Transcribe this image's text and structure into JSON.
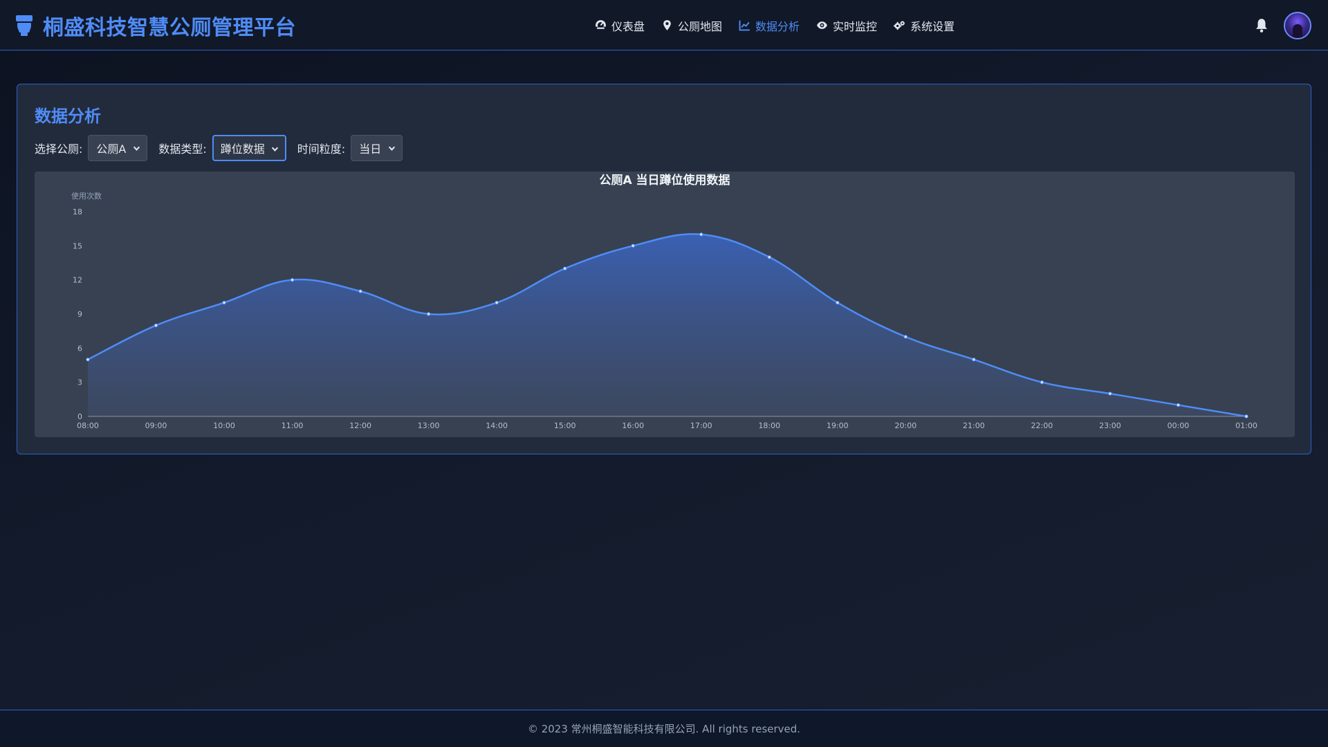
{
  "header": {
    "brand_title": "桐盛科技智慧公厕管理平台",
    "brand_icon": "toilet-icon",
    "nav": [
      {
        "label": "仪表盘",
        "icon": "gauge-icon",
        "active": false
      },
      {
        "label": "公厕地图",
        "icon": "map-pin-icon",
        "active": false
      },
      {
        "label": "数据分析",
        "icon": "chart-line-icon",
        "active": true
      },
      {
        "label": "实时监控",
        "icon": "eye-icon",
        "active": false
      },
      {
        "label": "系统设置",
        "icon": "gears-icon",
        "active": false
      }
    ],
    "notification_icon": "bell-icon",
    "accent_color": "#4f8cf7"
  },
  "panel": {
    "title": "数据分析",
    "filters": [
      {
        "label": "选择公厕:",
        "value": "公厕A"
      },
      {
        "label": "数据类型:",
        "value": "蹲位数据"
      },
      {
        "label": "时间粒度:",
        "value": "当日"
      }
    ]
  },
  "chart_data": {
    "type": "area",
    "title": "公厕A 当日蹲位使用数据",
    "ylabel": "使用次数",
    "xlabel": "",
    "categories": [
      "08:00",
      "09:00",
      "10:00",
      "11:00",
      "12:00",
      "13:00",
      "14:00",
      "15:00",
      "16:00",
      "17:00",
      "18:00",
      "19:00",
      "20:00",
      "21:00",
      "22:00",
      "23:00",
      "00:00",
      "01:00"
    ],
    "values": [
      5,
      8,
      10,
      12,
      11,
      9,
      10,
      13,
      15,
      16,
      14,
      10,
      7,
      5,
      3,
      2,
      1,
      0
    ],
    "y_ticks": [
      0,
      3,
      6,
      9,
      12,
      15,
      18
    ],
    "ylim": [
      0,
      18
    ],
    "smooth": true,
    "line_color": "#4f8cf7",
    "grid": false,
    "legend": "none"
  },
  "footer": {
    "text": "© 2023 常州桐盛智能科技有限公司. All rights reserved."
  }
}
